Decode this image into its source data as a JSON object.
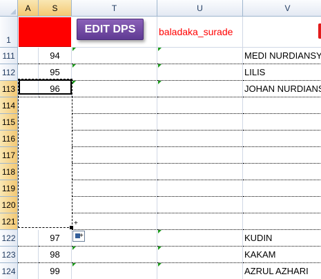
{
  "columns": [
    "A",
    "S",
    "T",
    "U",
    "V"
  ],
  "button": {
    "label": "EDIT DPS"
  },
  "u1_text": "baladaka_surade",
  "rows": [
    {
      "row": "1"
    },
    {
      "row": "111",
      "s": "94",
      "v": "MEDI NURDIANSYA"
    },
    {
      "row": "112",
      "s": "95",
      "v": "LILIS"
    },
    {
      "row": "113",
      "s": "96",
      "v": "JOHAN NURDIANS"
    },
    {
      "row": "114"
    },
    {
      "row": "115"
    },
    {
      "row": "116"
    },
    {
      "row": "117"
    },
    {
      "row": "118"
    },
    {
      "row": "119"
    },
    {
      "row": "120"
    },
    {
      "row": "121"
    },
    {
      "row": "122",
      "s": "97",
      "v": "KUDIN"
    },
    {
      "row": "123",
      "s": "98",
      "v": "KAKAM"
    },
    {
      "row": "124",
      "s": "99",
      "v": "AZRUL AZHARI"
    }
  ],
  "colors": {
    "header_fill": "#ff0000",
    "button_fill": "#6b46a0",
    "text_accent": "#ff0000",
    "marker": "#1a9a1a"
  }
}
